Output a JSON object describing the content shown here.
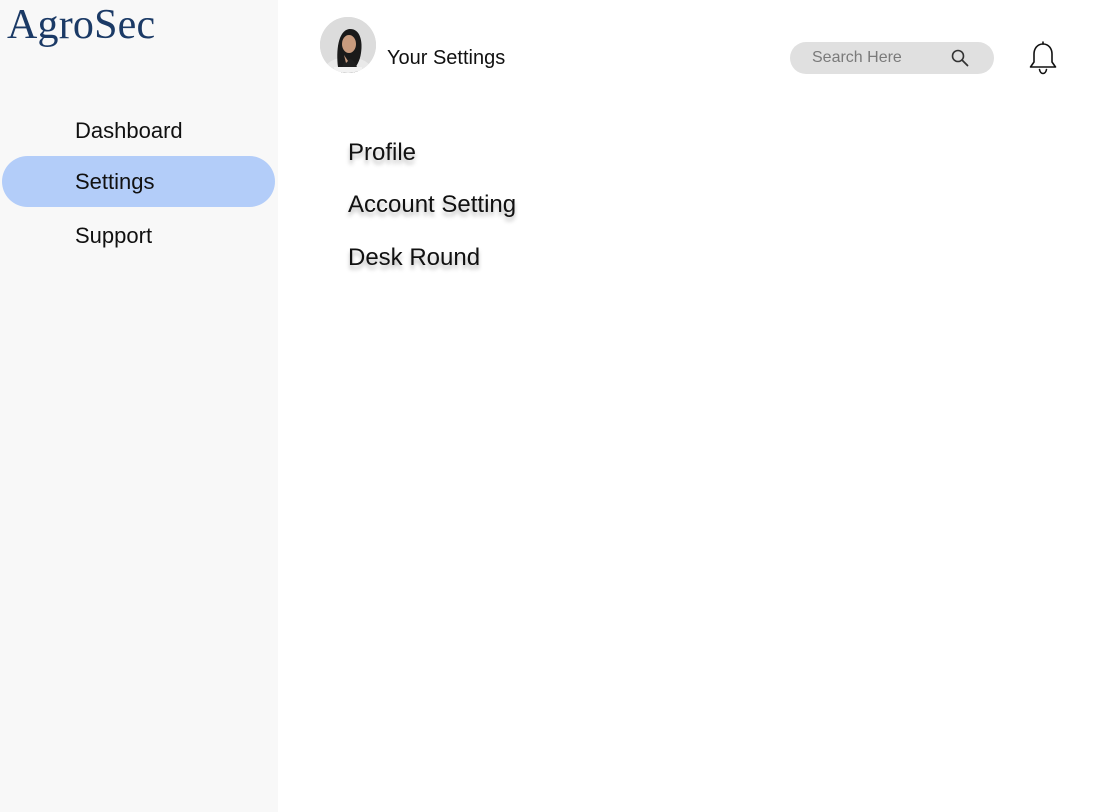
{
  "brand": {
    "name": "AgroSec",
    "color": "#1b3a66"
  },
  "sidebar": {
    "items": [
      {
        "label": "Dashboard",
        "active": false
      },
      {
        "label": "Settings",
        "active": true
      },
      {
        "label": "Support",
        "active": false
      }
    ],
    "active_color": "#b3cdf9"
  },
  "header": {
    "title": "Your Settings",
    "search": {
      "placeholder": "Search Here",
      "value": ""
    },
    "icons": [
      "user-avatar",
      "search-icon",
      "bell-icon"
    ]
  },
  "settings": {
    "items": [
      {
        "label": "Profile"
      },
      {
        "label": "Account Setting"
      },
      {
        "label": "Desk Round"
      }
    ]
  }
}
